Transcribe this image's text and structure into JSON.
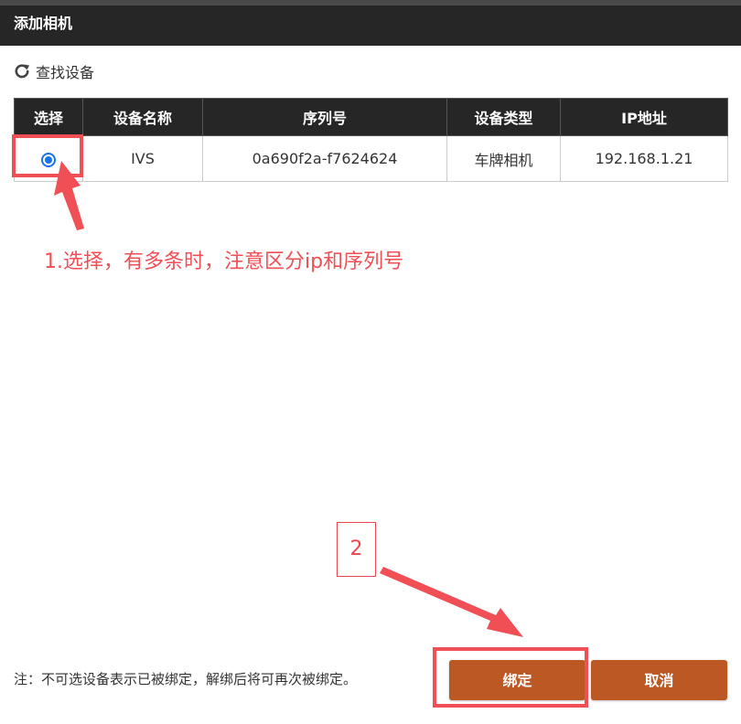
{
  "dialog": {
    "title": "添加相机",
    "search_label": "查找设备"
  },
  "table": {
    "columns": [
      "选择",
      "设备名称",
      "序列号",
      "设备类型",
      "IP地址"
    ],
    "rows": [
      {
        "selected": true,
        "name": "IVS",
        "serial": "0a690f2a-f7624624",
        "type": "车牌相机",
        "ip": "192.168.1.21"
      }
    ]
  },
  "annotations": {
    "step1": "1.选择，有多条时，注意区分ip和序列号",
    "step2": "2",
    "color": "#f04f56"
  },
  "footer": {
    "note": "注：不可选设备表示已被绑定，解绑后将可再次被绑定。",
    "bind_label": "绑定",
    "cancel_label": "取消"
  },
  "colors": {
    "titlebar": "#262626",
    "header": "#262626",
    "button": "#bb5824",
    "radio": "#1a73e8"
  },
  "icons": {
    "search": "refresh-icon"
  }
}
